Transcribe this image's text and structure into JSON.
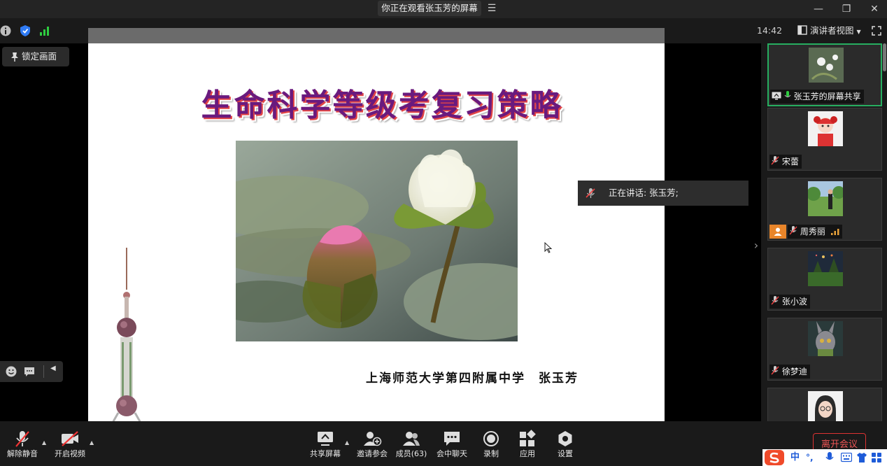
{
  "window": {
    "title": "你正在观看张玉芳的屏幕",
    "menu_icon": "list-menu-icon",
    "controls": [
      "minimize-icon",
      "restore-icon",
      "close-icon"
    ]
  },
  "infobar": {
    "time": "14:42",
    "view_mode_label": "演讲者视图",
    "icons": [
      "info-icon",
      "shield-icon",
      "signal-bars-icon",
      "fullscreen-icon"
    ]
  },
  "lock_button": {
    "label": "锁定画面"
  },
  "speaking_indicator": {
    "text": "正在讲话: 张玉芳;"
  },
  "slide": {
    "title": "生命科学等级考复习策略",
    "author": "上海师范大学第四附属中学　张玉芳"
  },
  "participants": [
    {
      "name": "张玉芳的屏幕共享",
      "active": true,
      "icon": "screen-share-icon"
    },
    {
      "name": "宋蕾",
      "active": false,
      "icon": "mic-muted-icon"
    },
    {
      "name": "周秀丽",
      "active": false,
      "icon": "mic-muted-icon"
    },
    {
      "name": "张小波",
      "active": false,
      "icon": "mic-muted-icon"
    },
    {
      "name": "徐梦迪",
      "active": false,
      "icon": "mic-muted-icon"
    }
  ],
  "toolbar": {
    "unmute": "解除静音",
    "start_video": "开启视频",
    "share_screen": "共享屏幕",
    "invite": "邀请参会",
    "members": "成员(63)",
    "chat": "会中聊天",
    "record": "录制",
    "apps": "应用",
    "settings": "设置",
    "leave": "离开会议"
  },
  "ime": {
    "lang": "中",
    "punct": "°,"
  },
  "colors": {
    "leave": "#dd3333",
    "active_tile": "#27ae60",
    "shield": "#2f7bf5"
  }
}
